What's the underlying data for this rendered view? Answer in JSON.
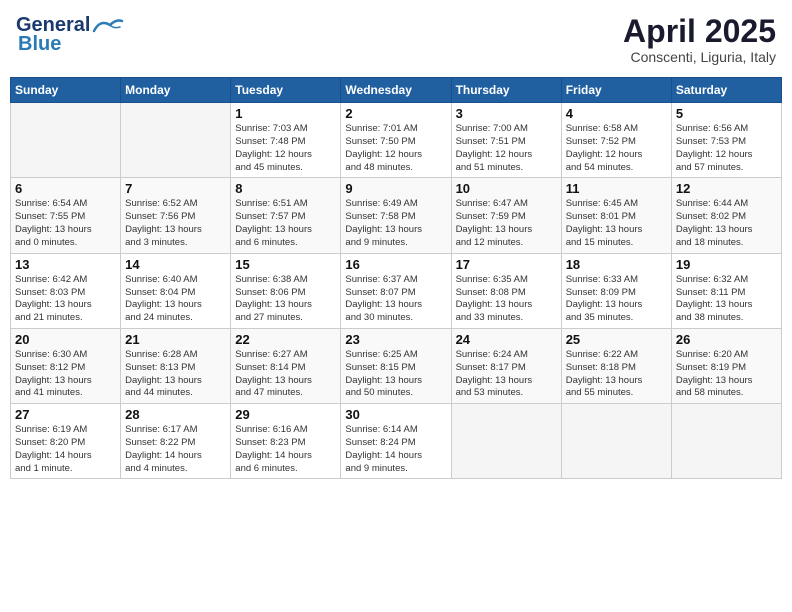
{
  "header": {
    "logo_line1": "General",
    "logo_line2": "Blue",
    "month": "April 2025",
    "location": "Conscenti, Liguria, Italy"
  },
  "weekdays": [
    "Sunday",
    "Monday",
    "Tuesday",
    "Wednesday",
    "Thursday",
    "Friday",
    "Saturday"
  ],
  "weeks": [
    [
      {
        "day": "",
        "info": ""
      },
      {
        "day": "",
        "info": ""
      },
      {
        "day": "1",
        "info": "Sunrise: 7:03 AM\nSunset: 7:48 PM\nDaylight: 12 hours\nand 45 minutes."
      },
      {
        "day": "2",
        "info": "Sunrise: 7:01 AM\nSunset: 7:50 PM\nDaylight: 12 hours\nand 48 minutes."
      },
      {
        "day": "3",
        "info": "Sunrise: 7:00 AM\nSunset: 7:51 PM\nDaylight: 12 hours\nand 51 minutes."
      },
      {
        "day": "4",
        "info": "Sunrise: 6:58 AM\nSunset: 7:52 PM\nDaylight: 12 hours\nand 54 minutes."
      },
      {
        "day": "5",
        "info": "Sunrise: 6:56 AM\nSunset: 7:53 PM\nDaylight: 12 hours\nand 57 minutes."
      }
    ],
    [
      {
        "day": "6",
        "info": "Sunrise: 6:54 AM\nSunset: 7:55 PM\nDaylight: 13 hours\nand 0 minutes."
      },
      {
        "day": "7",
        "info": "Sunrise: 6:52 AM\nSunset: 7:56 PM\nDaylight: 13 hours\nand 3 minutes."
      },
      {
        "day": "8",
        "info": "Sunrise: 6:51 AM\nSunset: 7:57 PM\nDaylight: 13 hours\nand 6 minutes."
      },
      {
        "day": "9",
        "info": "Sunrise: 6:49 AM\nSunset: 7:58 PM\nDaylight: 13 hours\nand 9 minutes."
      },
      {
        "day": "10",
        "info": "Sunrise: 6:47 AM\nSunset: 7:59 PM\nDaylight: 13 hours\nand 12 minutes."
      },
      {
        "day": "11",
        "info": "Sunrise: 6:45 AM\nSunset: 8:01 PM\nDaylight: 13 hours\nand 15 minutes."
      },
      {
        "day": "12",
        "info": "Sunrise: 6:44 AM\nSunset: 8:02 PM\nDaylight: 13 hours\nand 18 minutes."
      }
    ],
    [
      {
        "day": "13",
        "info": "Sunrise: 6:42 AM\nSunset: 8:03 PM\nDaylight: 13 hours\nand 21 minutes."
      },
      {
        "day": "14",
        "info": "Sunrise: 6:40 AM\nSunset: 8:04 PM\nDaylight: 13 hours\nand 24 minutes."
      },
      {
        "day": "15",
        "info": "Sunrise: 6:38 AM\nSunset: 8:06 PM\nDaylight: 13 hours\nand 27 minutes."
      },
      {
        "day": "16",
        "info": "Sunrise: 6:37 AM\nSunset: 8:07 PM\nDaylight: 13 hours\nand 30 minutes."
      },
      {
        "day": "17",
        "info": "Sunrise: 6:35 AM\nSunset: 8:08 PM\nDaylight: 13 hours\nand 33 minutes."
      },
      {
        "day": "18",
        "info": "Sunrise: 6:33 AM\nSunset: 8:09 PM\nDaylight: 13 hours\nand 35 minutes."
      },
      {
        "day": "19",
        "info": "Sunrise: 6:32 AM\nSunset: 8:11 PM\nDaylight: 13 hours\nand 38 minutes."
      }
    ],
    [
      {
        "day": "20",
        "info": "Sunrise: 6:30 AM\nSunset: 8:12 PM\nDaylight: 13 hours\nand 41 minutes."
      },
      {
        "day": "21",
        "info": "Sunrise: 6:28 AM\nSunset: 8:13 PM\nDaylight: 13 hours\nand 44 minutes."
      },
      {
        "day": "22",
        "info": "Sunrise: 6:27 AM\nSunset: 8:14 PM\nDaylight: 13 hours\nand 47 minutes."
      },
      {
        "day": "23",
        "info": "Sunrise: 6:25 AM\nSunset: 8:15 PM\nDaylight: 13 hours\nand 50 minutes."
      },
      {
        "day": "24",
        "info": "Sunrise: 6:24 AM\nSunset: 8:17 PM\nDaylight: 13 hours\nand 53 minutes."
      },
      {
        "day": "25",
        "info": "Sunrise: 6:22 AM\nSunset: 8:18 PM\nDaylight: 13 hours\nand 55 minutes."
      },
      {
        "day": "26",
        "info": "Sunrise: 6:20 AM\nSunset: 8:19 PM\nDaylight: 13 hours\nand 58 minutes."
      }
    ],
    [
      {
        "day": "27",
        "info": "Sunrise: 6:19 AM\nSunset: 8:20 PM\nDaylight: 14 hours\nand 1 minute."
      },
      {
        "day": "28",
        "info": "Sunrise: 6:17 AM\nSunset: 8:22 PM\nDaylight: 14 hours\nand 4 minutes."
      },
      {
        "day": "29",
        "info": "Sunrise: 6:16 AM\nSunset: 8:23 PM\nDaylight: 14 hours\nand 6 minutes."
      },
      {
        "day": "30",
        "info": "Sunrise: 6:14 AM\nSunset: 8:24 PM\nDaylight: 14 hours\nand 9 minutes."
      },
      {
        "day": "",
        "info": ""
      },
      {
        "day": "",
        "info": ""
      },
      {
        "day": "",
        "info": ""
      }
    ]
  ]
}
